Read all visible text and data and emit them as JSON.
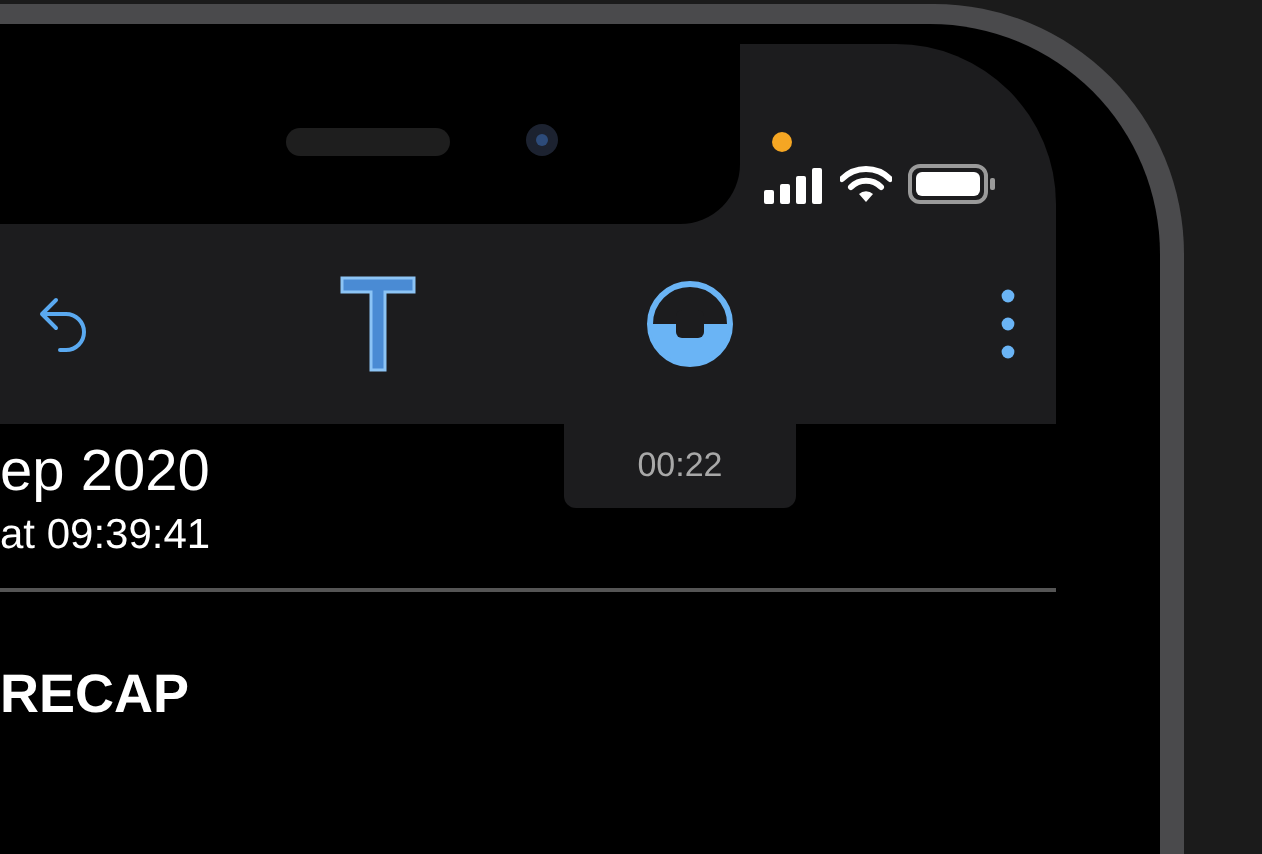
{
  "toolbar": {
    "timer": "00:22"
  },
  "note": {
    "date": "ep 2020",
    "time": "at 09:39:41",
    "heading": "RECAP"
  }
}
